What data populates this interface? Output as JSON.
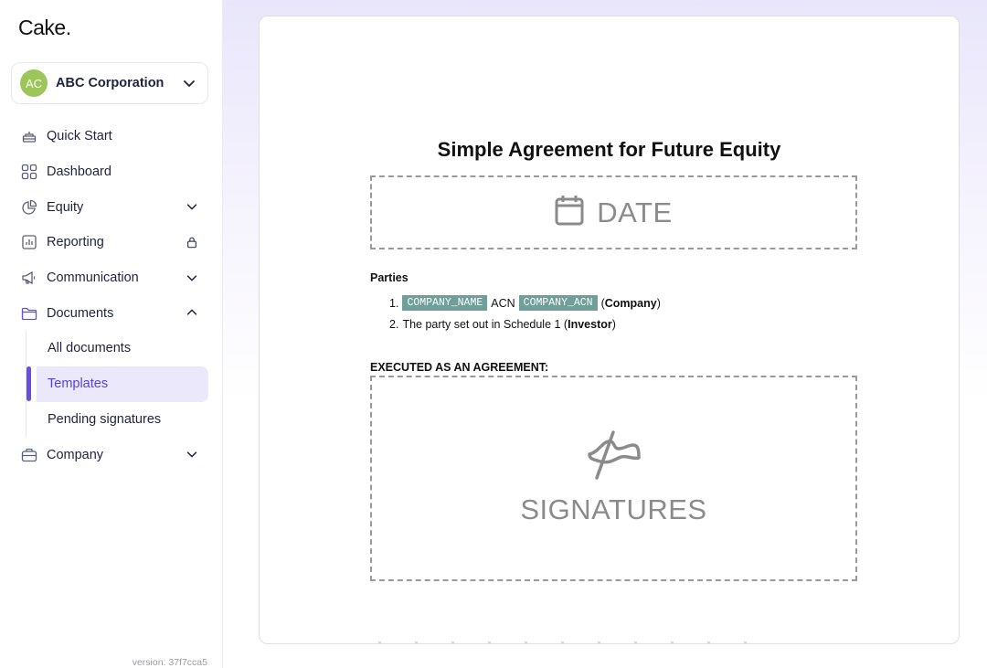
{
  "sidebar": {
    "logo": "Cake.",
    "org": {
      "initials": "AC",
      "name": "ABC Corporation"
    },
    "nav": [
      {
        "label": "Quick Start",
        "icon": "cake-icon"
      },
      {
        "label": "Dashboard",
        "icon": "grid-icon"
      },
      {
        "label": "Equity",
        "icon": "pie-chart-icon"
      },
      {
        "label": "Reporting",
        "icon": "bar-chart-icon"
      },
      {
        "label": "Communication",
        "icon": "megaphone-icon"
      },
      {
        "label": "Documents",
        "icon": "folder-icon"
      }
    ],
    "documents_sub": [
      {
        "label": "All documents"
      },
      {
        "label": "Templates"
      },
      {
        "label": "Pending signatures"
      }
    ],
    "company": {
      "label": "Company",
      "icon": "briefcase-icon"
    },
    "version": "version: 37f7cca5"
  },
  "document": {
    "title": "Simple Agreement for Future Equity",
    "date_placeholder": "DATE",
    "parties_heading": "Parties",
    "party1": {
      "num": "1.",
      "tag1": "COMPANY_NAME",
      "mid": "ACN",
      "tag2": "COMPANY_ACN",
      "open": "(",
      "bold": "Company",
      "close": ")"
    },
    "party2": {
      "num": "2.",
      "text": "The party set out in Schedule 1 (",
      "bold": "Investor",
      "close": ")"
    },
    "executed_heading": "EXECUTED AS AN AGREEMENT:",
    "signatures_placeholder": "SIGNATURES"
  },
  "colors": {
    "accent": "#6a4be6",
    "active_bg": "#ebe8fb",
    "avatar": "#9cc55a",
    "tag": "#6f9f99"
  }
}
